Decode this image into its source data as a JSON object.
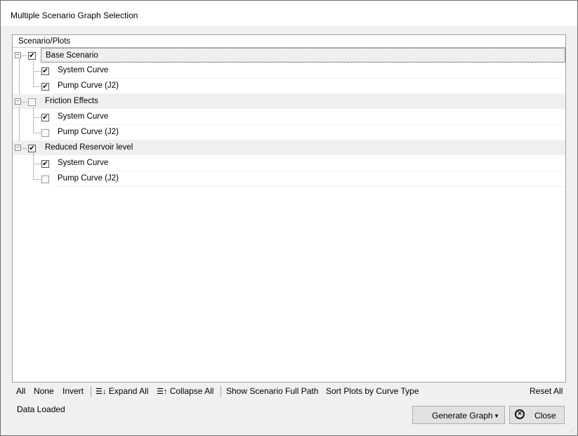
{
  "window": {
    "title": "Multiple Scenario Graph Selection"
  },
  "tree": {
    "column_header": "Scenario/Plots",
    "scenarios": [
      {
        "label": "Base Scenario",
        "checked": true,
        "plots": [
          {
            "label": "System Curve",
            "checked": true
          },
          {
            "label": "Pump Curve (J2)",
            "checked": true
          }
        ]
      },
      {
        "label": "Friction Effects",
        "checked": false,
        "plots": [
          {
            "label": "System Curve",
            "checked": true
          },
          {
            "label": "Pump Curve (J2)",
            "checked": false
          }
        ]
      },
      {
        "label": "Reduced Reservoir level",
        "checked": true,
        "plots": [
          {
            "label": "System Curve",
            "checked": true
          },
          {
            "label": "Pump Curve (J2)",
            "checked": false
          }
        ]
      }
    ]
  },
  "toolbar": {
    "all": "All",
    "none": "None",
    "invert": "Invert",
    "expand_all": "Expand All",
    "collapse_all": "Collapse All",
    "show_full_path": "Show Scenario Full Path",
    "sort_plots": "Sort Plots by Curve Type",
    "reset_all": "Reset All"
  },
  "status": "Data Loaded",
  "buttons": {
    "generate_graph": "Generate Graph",
    "close": "Close"
  }
}
